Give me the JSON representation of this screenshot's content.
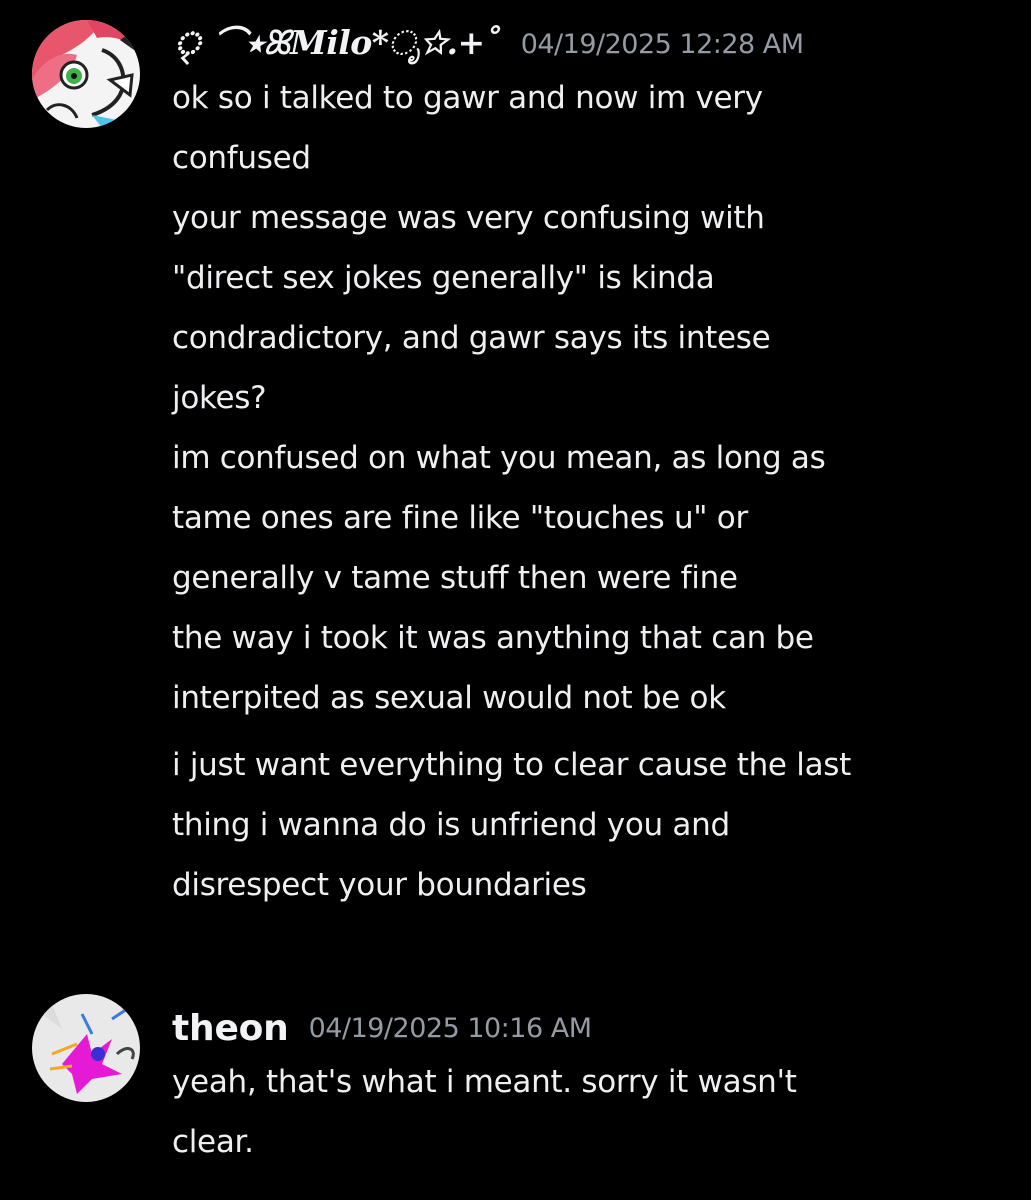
{
  "messages": [
    {
      "username": "ৃ ⌒⭑ꕤ𝑴𝒊𝒍𝒐*ೃ☆.+˚",
      "timestamp": "04/19/2025 12:28 AM",
      "lines": [
        "ok so i talked to gawr and now im very",
        "confused",
        "your message was very confusing with",
        "\"direct sex jokes generally\" is kinda",
        "condradictory, and gawr says its intese",
        "jokes?",
        "im confused on what you mean, as long as",
        "tame ones are fine like \"touches u\" or",
        "generally v tame stuff then were fine",
        "the way i took it was anything that can be",
        "interpited as sexual would not be ok",
        "i just want everything to clear cause the last",
        "thing i wanna do is unfriend you and",
        "disrespect your boundaries"
      ]
    },
    {
      "username": "theon",
      "timestamp": "04/19/2025 10:16 AM",
      "lines": [
        "yeah, that's what i meant. sorry it wasn't",
        "clear."
      ]
    }
  ],
  "colors": {
    "background": "#000000",
    "text": "#eeeff1",
    "username": "#f2f3f5",
    "timestamp": "#949ba4"
  },
  "icons": [
    "milo-avatar",
    "theon-avatar"
  ]
}
